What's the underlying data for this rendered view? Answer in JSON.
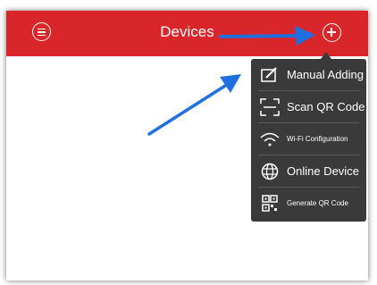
{
  "header": {
    "title": "Devices",
    "menu_icon": "menu-circle-icon",
    "add_icon": "plus-circle-icon",
    "background": "#d9262a"
  },
  "dropdown": {
    "items": [
      {
        "label": "Manual Adding",
        "icon": "edit-pencil-icon"
      },
      {
        "label": "Scan QR Code",
        "icon": "scan-qr-icon"
      },
      {
        "label": "Wi-Fi Configuration",
        "icon": "wifi-icon"
      },
      {
        "label": "Online Device",
        "icon": "globe-icon"
      },
      {
        "label": "Generate QR Code",
        "icon": "qr-code-icon"
      }
    ],
    "background": "#3a3a3a"
  },
  "annotation": {
    "arrow_color": "#1f6fe0"
  }
}
